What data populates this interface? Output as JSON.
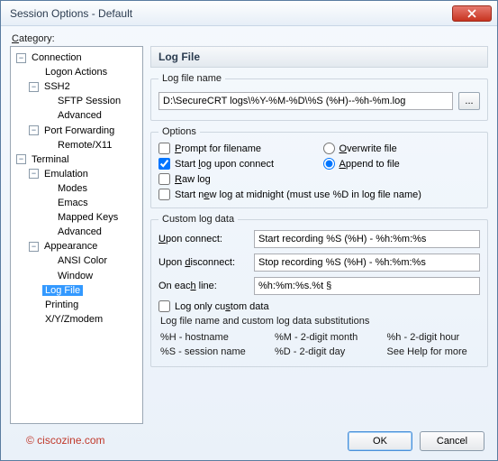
{
  "window": {
    "title": "Session Options - Default"
  },
  "category_label": "Category:",
  "tree": {
    "connection": "Connection",
    "logon_actions": "Logon Actions",
    "ssh2": "SSH2",
    "sftp_session": "SFTP Session",
    "advanced1": "Advanced",
    "port_forwarding": "Port Forwarding",
    "remote_x11": "Remote/X11",
    "terminal": "Terminal",
    "emulation": "Emulation",
    "modes": "Modes",
    "emacs": "Emacs",
    "mapped_keys": "Mapped Keys",
    "advanced2": "Advanced",
    "appearance": "Appearance",
    "ansi_color": "ANSI Color",
    "window_item": "Window",
    "log_file": "Log File",
    "printing": "Printing",
    "xyz": "X/Y/Zmodem"
  },
  "panel": {
    "heading": "Log File",
    "filename_group": "Log file name",
    "filename_value": "D:\\SecureCRT logs\\%Y-%M-%D\\%S (%H)--%h-%m.log",
    "browse_label": "...",
    "options_group": "Options",
    "prompt": "Prompt for filename",
    "overwrite": "Overwrite file",
    "start_on_connect": "Start log upon connect",
    "append": "Append to file",
    "raw": "Raw log",
    "midnight": "Start new log at midnight (must use %D in log file name)",
    "custom_group": "Custom log data",
    "upon_connect_label": "Upon connect:",
    "upon_connect_value": "Start recording %S (%H) - %h:%m:%s",
    "upon_disconnect_label": "Upon disconnect:",
    "upon_disconnect_value": "Stop recording %S (%H) - %h:%m:%s",
    "each_line_label": "On each line:",
    "each_line_value": "%h:%m:%s.%t §",
    "log_only_custom": "Log only custom data",
    "subs_title": "Log file name and custom log data substitutions",
    "subs": {
      "a": "%H - hostname",
      "b": "%M - 2-digit month",
      "c": "%h  -  2-digit hour",
      "d": "%S - session name",
      "e": "%D - 2-digit day",
      "f": "See Help for more"
    }
  },
  "buttons": {
    "ok": "OK",
    "cancel": "Cancel"
  },
  "watermark": "© ciscozine.com"
}
